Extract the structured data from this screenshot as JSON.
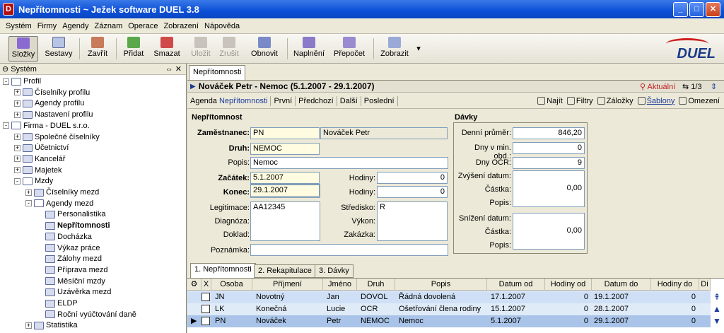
{
  "window": {
    "title": "Nepřítomnosti ~ Ježek software DUEL 3.8",
    "min": "_",
    "max": "□",
    "close": "✕",
    "app_icon": "D"
  },
  "menu": [
    "Systém",
    "Firmy",
    "Agendy",
    "Záznam",
    "Operace",
    "Zobrazení",
    "Nápověda"
  ],
  "toolbar": {
    "slozky": "Složky",
    "sestavy": "Sestavy",
    "zavrit": "Zavřít",
    "pridat": "Přidat",
    "smazat": "Smazat",
    "ulozit": "Uložit",
    "zrusit": "Zrušit",
    "obnovit": "Obnovit",
    "naplneni": "Naplnění",
    "prepocet": "Přepočet",
    "zobrazit": "Zobrazit",
    "dropdown": "▾"
  },
  "logo": "DUEL",
  "tree": {
    "header": "Systém",
    "header_icons": "⇔ ✕",
    "items": [
      {
        "label": "Profil"
      },
      {
        "label": "Číselníky profilu"
      },
      {
        "label": "Agendy profilu"
      },
      {
        "label": "Nastavení profilu"
      },
      {
        "label": "Firma - DUEL s.r.o."
      },
      {
        "label": "Společné číselníky"
      },
      {
        "label": "Účetnictví"
      },
      {
        "label": "Kancelář"
      },
      {
        "label": "Majetek"
      },
      {
        "label": "Mzdy"
      },
      {
        "label": "Číselníky mezd"
      },
      {
        "label": "Agendy mezd"
      },
      {
        "label": "Personalistika"
      },
      {
        "label": "Nepřítomnosti"
      },
      {
        "label": "Docházka"
      },
      {
        "label": "Výkaz práce"
      },
      {
        "label": "Zálohy mezd"
      },
      {
        "label": "Příprava mezd"
      },
      {
        "label": "Měsíční mzdy"
      },
      {
        "label": "Uzávěrka mezd"
      },
      {
        "label": "ELDP"
      },
      {
        "label": "Roční vyúčtování daně"
      },
      {
        "label": "Statistika"
      }
    ]
  },
  "tab_top": "Nepřítomnosti",
  "header": {
    "title": "Nováček Petr - Nemoc (5.1.2007 - 29.1.2007)",
    "aktualni": "Aktuální",
    "pager": "1/3"
  },
  "nav": {
    "agenda_prefix": "Agenda ",
    "agenda_link": "Nepřítomnosti",
    "prvni": "První",
    "predchozi": "Předchozí",
    "dalsi": "Další",
    "posledni": "Poslední",
    "najit": "Najít",
    "filtry": "Filtry",
    "zalozky": "Záložky",
    "sablony": "Šablony",
    "omezeni": "Omezení"
  },
  "form": {
    "sec1": "Nepřítomnost",
    "sec2": "Dávky",
    "zamestnanec_label": "Zaměstnanec:",
    "zamestnanec_code": "PN",
    "zamestnanec_name": "Nováček Petr",
    "druh_label": "Druh:",
    "druh": "NEMOC",
    "popis_label": "Popis:",
    "popis": "Nemoc",
    "zacatek_label": "Začátek:",
    "zacatek": "5.1.2007",
    "konec_label": "Konec:",
    "konec": "29.1.2007",
    "hodiny_label": "Hodiny:",
    "hodiny1": "0",
    "hodiny2": "0",
    "legitimace_label": "Legitimace:",
    "legitimace": "AA12345",
    "diagnoza_label": "Diagnóza:",
    "doklad_label": "Doklad:",
    "stredisko_label": "Středisko:",
    "stredisko": "R",
    "vykon_label": "Výkon:",
    "zakazka_label": "Zakázka:",
    "poznamka_label": "Poznámka:",
    "denni_label": "Denní průměr:",
    "denni": "846,20",
    "dny_min_label": "Dny v min. obd.:",
    "dny_min": "0",
    "dny_ocr_label": "Dny OČR:",
    "dny_ocr": "9",
    "zvyseni_label": "Zvýšení datum:",
    "castka_label": "Částka:",
    "castka1": "0,00",
    "popis2_label": "Popis:",
    "snizeni_label": "Snížení datum:",
    "castka2": "0,00"
  },
  "bottom_tabs": [
    "1. Nepřítomnosti",
    "2. Rekapitulace",
    "3. Dávky"
  ],
  "grid": {
    "columns": [
      "",
      "X",
      "Osoba",
      "Příjmení",
      "Jméno",
      "Druh",
      "Popis",
      "Datum od",
      "Hodiny od",
      "Datum do",
      "Hodiny do",
      "Di"
    ],
    "rows": [
      {
        "marker": "",
        "osoba": "JN",
        "prijmeni": "Novotný",
        "jmeno": "Jan",
        "druh": "DOVOL",
        "popis": "Řádná dovolená",
        "datum_od": "17.1.2007",
        "hodiny_od": "0",
        "datum_do": "19.1.2007",
        "hodiny_do": "0"
      },
      {
        "marker": "",
        "osoba": "LK",
        "prijmeni": "Konečná",
        "jmeno": "Lucie",
        "druh": "OCR",
        "popis": "Ošetřování člena rodiny",
        "datum_od": "15.1.2007",
        "hodiny_od": "0",
        "datum_do": "28.1.2007",
        "hodiny_do": "0"
      },
      {
        "marker": "▶",
        "osoba": "PN",
        "prijmeni": "Nováček",
        "jmeno": "Petr",
        "druh": "NEMOC",
        "popis": "Nemoc",
        "datum_od": "5.1.2007",
        "hodiny_od": "0",
        "datum_do": "29.1.2007",
        "hodiny_do": "0"
      }
    ]
  },
  "colors": {
    "titlebar": "#0c4fd6",
    "selected_row": "#a9c4e8",
    "required_field": "#fefbe0"
  }
}
